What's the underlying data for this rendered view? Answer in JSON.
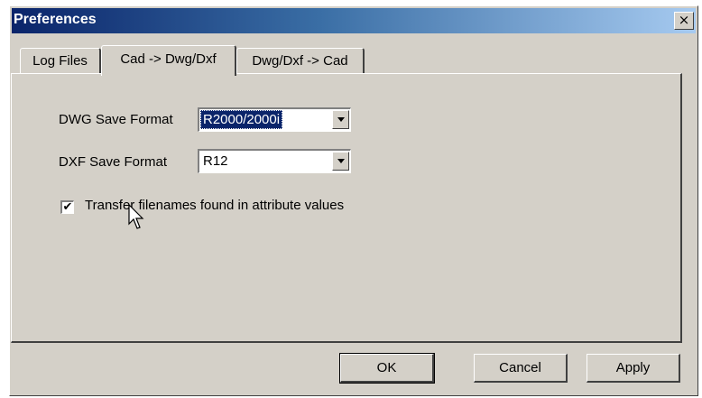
{
  "window": {
    "title": "Preferences",
    "close_symbol": "×"
  },
  "tabs": [
    {
      "label": "Log Files",
      "active": false
    },
    {
      "label": "Cad -> Dwg/Dxf",
      "active": true
    },
    {
      "label": "Dwg/Dxf -> Cad",
      "active": false
    }
  ],
  "fields": {
    "dwg_label": "DWG Save Format",
    "dwg_value": "R2000/2000i",
    "dxf_label": "DXF Save Format",
    "dxf_value": "R12"
  },
  "options": {
    "transfer_label": "Transfer filenames found in attribute values",
    "transfer_checked": true,
    "check_glyph": "✔"
  },
  "buttons": {
    "ok": "OK",
    "cancel": "Cancel",
    "apply": "Apply"
  },
  "colors": {
    "title_start": "#0a246a",
    "title_end": "#a6caf0",
    "face": "#d4d0c8",
    "selection": "#0a246a"
  }
}
